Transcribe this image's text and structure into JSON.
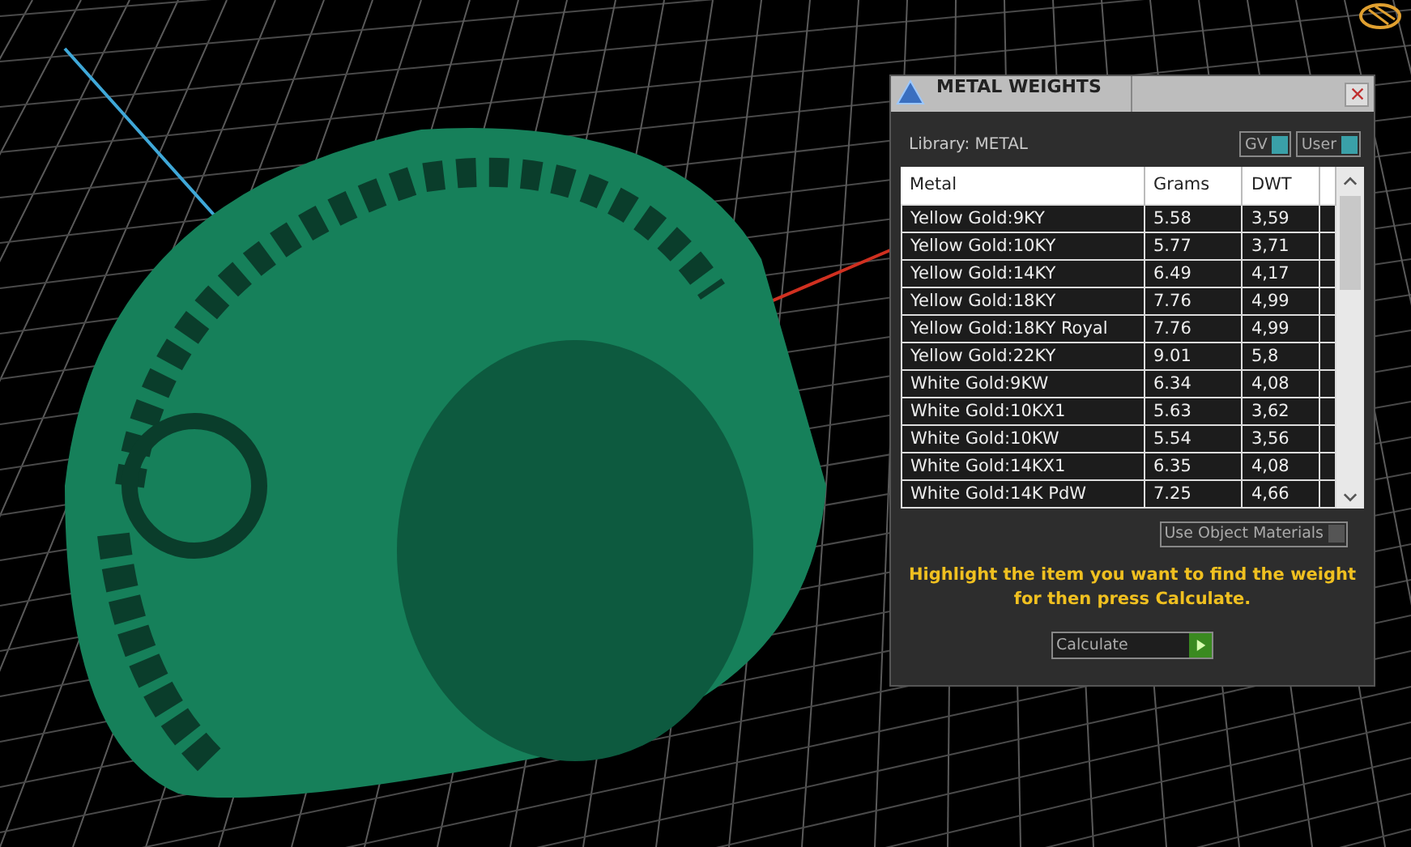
{
  "window": {
    "title": "METAL WEIGHTS"
  },
  "library": {
    "label": "Library: METAL"
  },
  "toggles": [
    {
      "label": "GV",
      "on": true
    },
    {
      "label": "User",
      "on": true
    }
  ],
  "table": {
    "columns": [
      "Metal",
      "Grams",
      "DWT"
    ],
    "rows": [
      {
        "metal": "Yellow Gold:9KY",
        "grams": "5.58",
        "dwt": "3,59"
      },
      {
        "metal": "Yellow Gold:10KY",
        "grams": "5.77",
        "dwt": "3,71"
      },
      {
        "metal": "Yellow Gold:14KY",
        "grams": "6.49",
        "dwt": "4,17"
      },
      {
        "metal": "Yellow Gold:18KY",
        "grams": "7.76",
        "dwt": "4,99"
      },
      {
        "metal": "Yellow Gold:18KY Royal",
        "grams": "7.76",
        "dwt": "4,99"
      },
      {
        "metal": "Yellow Gold:22KY",
        "grams": "9.01",
        "dwt": "5,8"
      },
      {
        "metal": "White Gold:9KW",
        "grams": "6.34",
        "dwt": "4,08"
      },
      {
        "metal": "White Gold:10KX1",
        "grams": "5.63",
        "dwt": "3,62"
      },
      {
        "metal": "White Gold:10KW",
        "grams": "5.54",
        "dwt": "3,56"
      },
      {
        "metal": "White Gold:14KX1",
        "grams": "6.35",
        "dwt": "4,08"
      },
      {
        "metal": "White Gold:14K PdW",
        "grams": "7.25",
        "dwt": "4,66"
      }
    ]
  },
  "use_object_materials": {
    "label": "Use Object Materials",
    "on": false
  },
  "hint": "Highlight the item you want to find the weight for then press Calculate.",
  "calculate_button": {
    "label": "Calculate"
  }
}
